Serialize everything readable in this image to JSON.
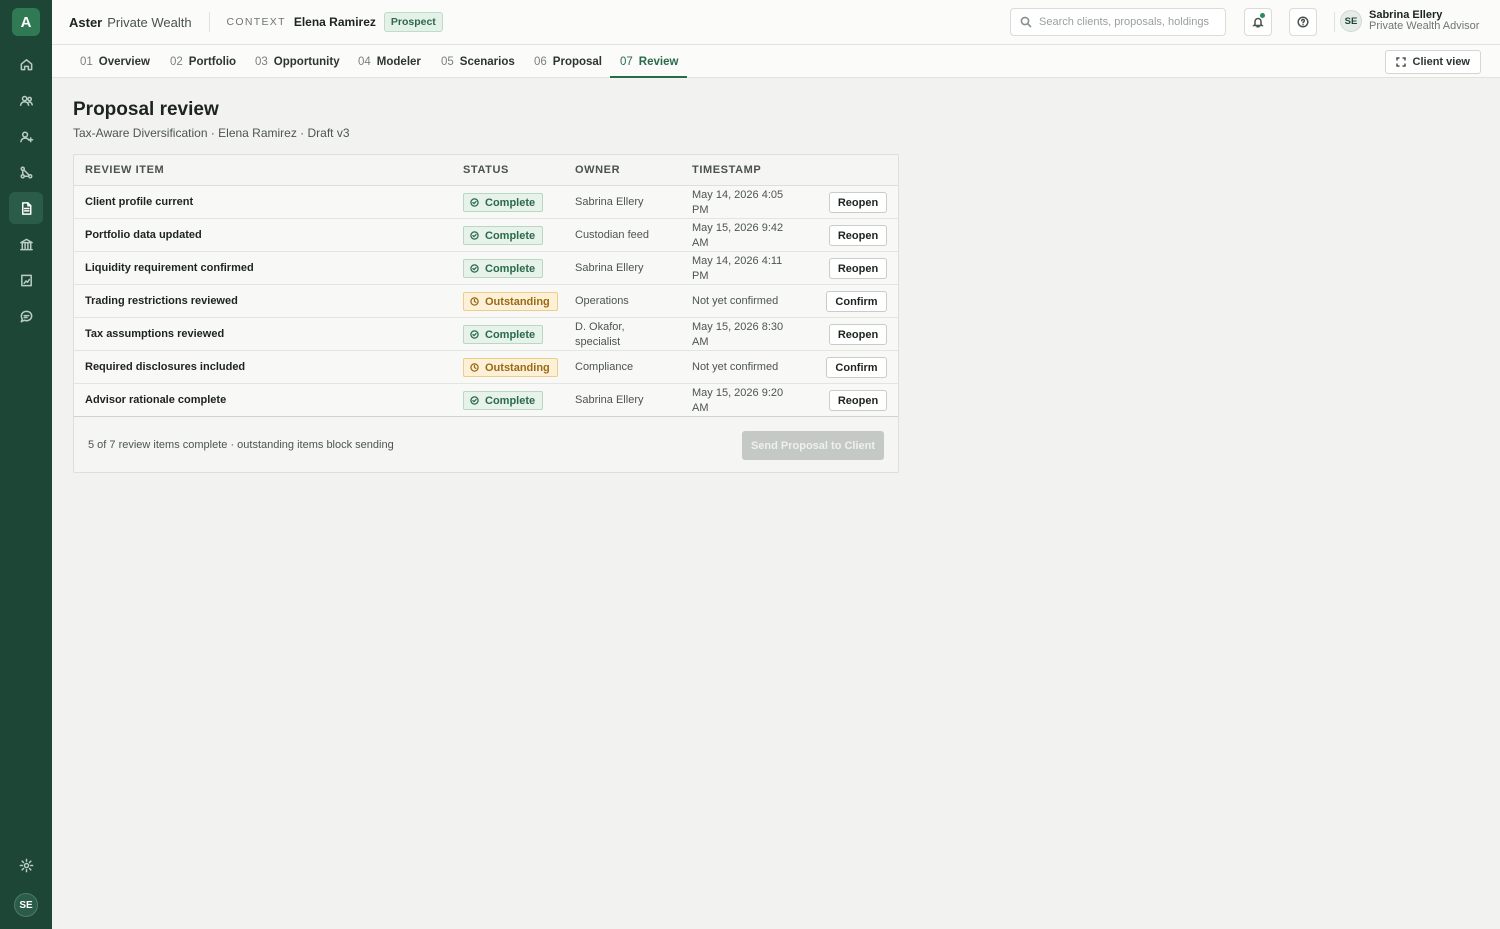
{
  "app": {
    "logo_letter": "A",
    "brand_primary": "Aster",
    "brand_secondary": "Private Wealth",
    "accent_color": "#2a6a4a",
    "sidebar_color": "#1e4636"
  },
  "sidebar": {
    "items": [
      {
        "icon": "home-icon"
      },
      {
        "icon": "users-icon"
      },
      {
        "icon": "add-user-icon"
      },
      {
        "icon": "workflow-icon"
      },
      {
        "icon": "document-icon",
        "active": true
      },
      {
        "icon": "bank-icon"
      },
      {
        "icon": "report-icon"
      },
      {
        "icon": "chat-icon"
      }
    ],
    "settings_icon": "gear-icon",
    "avatar_initials": "SE"
  },
  "header": {
    "context_label": "CONTEXT",
    "context_name": "Elena Ramirez",
    "context_badge": "Prospect",
    "search_placeholder": "Search clients, proposals, holdings",
    "user_initials": "SE",
    "user_name": "Sabrina Ellery",
    "user_role": "Private Wealth Advisor"
  },
  "tabs": [
    {
      "num": "01",
      "label": "Overview"
    },
    {
      "num": "02",
      "label": "Portfolio"
    },
    {
      "num": "03",
      "label": "Opportunity"
    },
    {
      "num": "04",
      "label": "Modeler"
    },
    {
      "num": "05",
      "label": "Scenarios"
    },
    {
      "num": "06",
      "label": "Proposal"
    },
    {
      "num": "07",
      "label": "Review",
      "active": true
    }
  ],
  "client_view_label": "Client view",
  "page": {
    "title": "Proposal review",
    "subtitle": "Tax-Aware Diversification · Elena Ramirez · Draft v3"
  },
  "table": {
    "headers": [
      "REVIEW ITEM",
      "STATUS",
      "OWNER",
      "TIMESTAMP"
    ],
    "rows": [
      {
        "item": "Client profile current",
        "status": "Complete",
        "owner": "Sabrina Ellery",
        "timestamp": "May 14, 2026 4:05 PM",
        "action": "Reopen"
      },
      {
        "item": "Portfolio data updated",
        "status": "Complete",
        "owner": "Custodian feed",
        "timestamp": "May 15, 2026 9:42 AM",
        "action": "Reopen"
      },
      {
        "item": "Liquidity requirement confirmed",
        "status": "Complete",
        "owner": "Sabrina Ellery",
        "timestamp": "May 14, 2026 4:11 PM",
        "action": "Reopen"
      },
      {
        "item": "Trading restrictions reviewed",
        "status": "Outstanding",
        "owner": "Operations",
        "timestamp": "Not yet confirmed",
        "action": "Confirm"
      },
      {
        "item": "Tax assumptions reviewed",
        "status": "Complete",
        "owner": "D. Okafor, specialist",
        "timestamp": "May 15, 2026 8:30 AM",
        "action": "Reopen"
      },
      {
        "item": "Required disclosures included",
        "status": "Outstanding",
        "owner": "Compliance",
        "timestamp": "Not yet confirmed",
        "action": "Confirm"
      },
      {
        "item": "Advisor rationale complete",
        "status": "Complete",
        "owner": "Sabrina Ellery",
        "timestamp": "May 15, 2026 9:20 AM",
        "action": "Reopen"
      }
    ],
    "footer_text": "5 of 7 review items complete · outstanding items block sending",
    "send_label": "Send Proposal to Client"
  }
}
